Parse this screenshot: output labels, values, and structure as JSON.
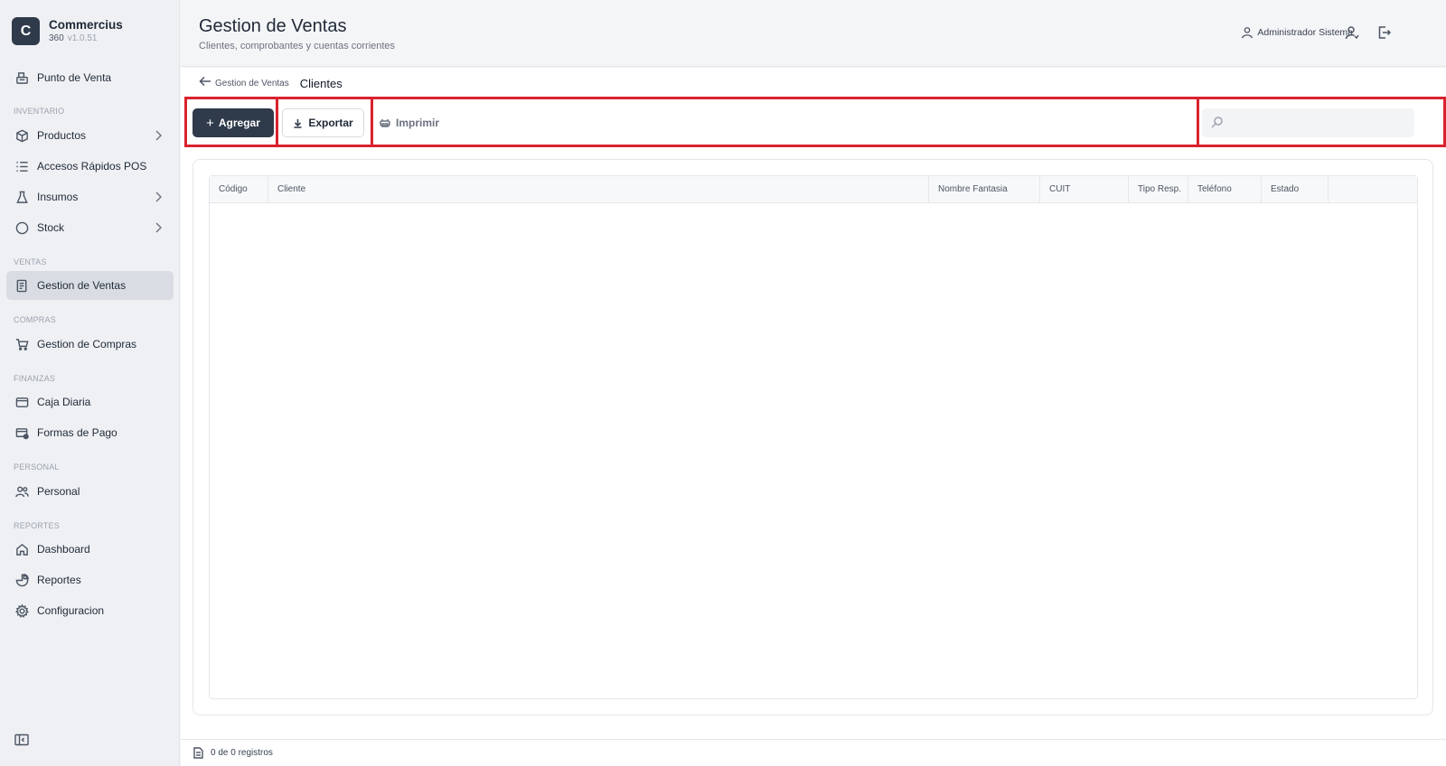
{
  "brand": {
    "logo_letter": "C",
    "name": "Commercius",
    "edition": "360",
    "version": "v1.0.51"
  },
  "sidebar": {
    "top_item": {
      "label": "Punto de Venta",
      "icon": "pos-icon"
    },
    "sections": [
      {
        "label": "INVENTARIO",
        "items": [
          {
            "label": "Productos",
            "icon": "box-icon",
            "has_submenu": true
          },
          {
            "label": "Accesos Rápidos POS",
            "icon": "list-icon",
            "has_submenu": false
          },
          {
            "label": "Insumos",
            "icon": "flask-icon",
            "has_submenu": true
          },
          {
            "label": "Stock",
            "icon": "circle-icon",
            "has_submenu": true
          }
        ]
      },
      {
        "label": "VENTAS",
        "items": [
          {
            "label": "Gestion de Ventas",
            "icon": "receipt-icon",
            "active": true
          }
        ]
      },
      {
        "label": "COMPRAS",
        "items": [
          {
            "label": "Gestion de Compras",
            "icon": "cart-icon"
          }
        ]
      },
      {
        "label": "FINANZAS",
        "items": [
          {
            "label": "Caja Diaria",
            "icon": "wallet-icon"
          },
          {
            "label": "Formas de Pago",
            "icon": "card-icon"
          }
        ]
      },
      {
        "label": "PERSONAL",
        "items": [
          {
            "label": "Personal",
            "icon": "users-icon"
          }
        ]
      },
      {
        "label": "REPORTES",
        "items": [
          {
            "label": "Dashboard",
            "icon": "home-icon"
          },
          {
            "label": "Reportes",
            "icon": "chart-icon"
          },
          {
            "label": "Configuracion",
            "icon": "gear-icon"
          }
        ]
      }
    ]
  },
  "header": {
    "title": "Gestion de Ventas",
    "subtitle": "Clientes, comprobantes y cuentas corrientes",
    "user_name": "Administrador Sistema"
  },
  "breadcrumb": {
    "parent": "Gestion de Ventas",
    "current": "Clientes"
  },
  "toolbar": {
    "add_label": "Agregar",
    "export_label": "Exportar",
    "print_label": "Imprimir",
    "search_value": "",
    "search_placeholder": ""
  },
  "table": {
    "columns": [
      "Código",
      "Cliente",
      "Nombre Fantasia",
      "CUIT",
      "Tipo Resp.",
      "Teléfono",
      "Estado",
      ""
    ],
    "rows": []
  },
  "footer": {
    "records_text": "0 de 0 registros"
  },
  "colors": {
    "primary": "#2f3a4b",
    "highlight_outline": "#d9232e",
    "active_nav": "#d9dde3"
  }
}
